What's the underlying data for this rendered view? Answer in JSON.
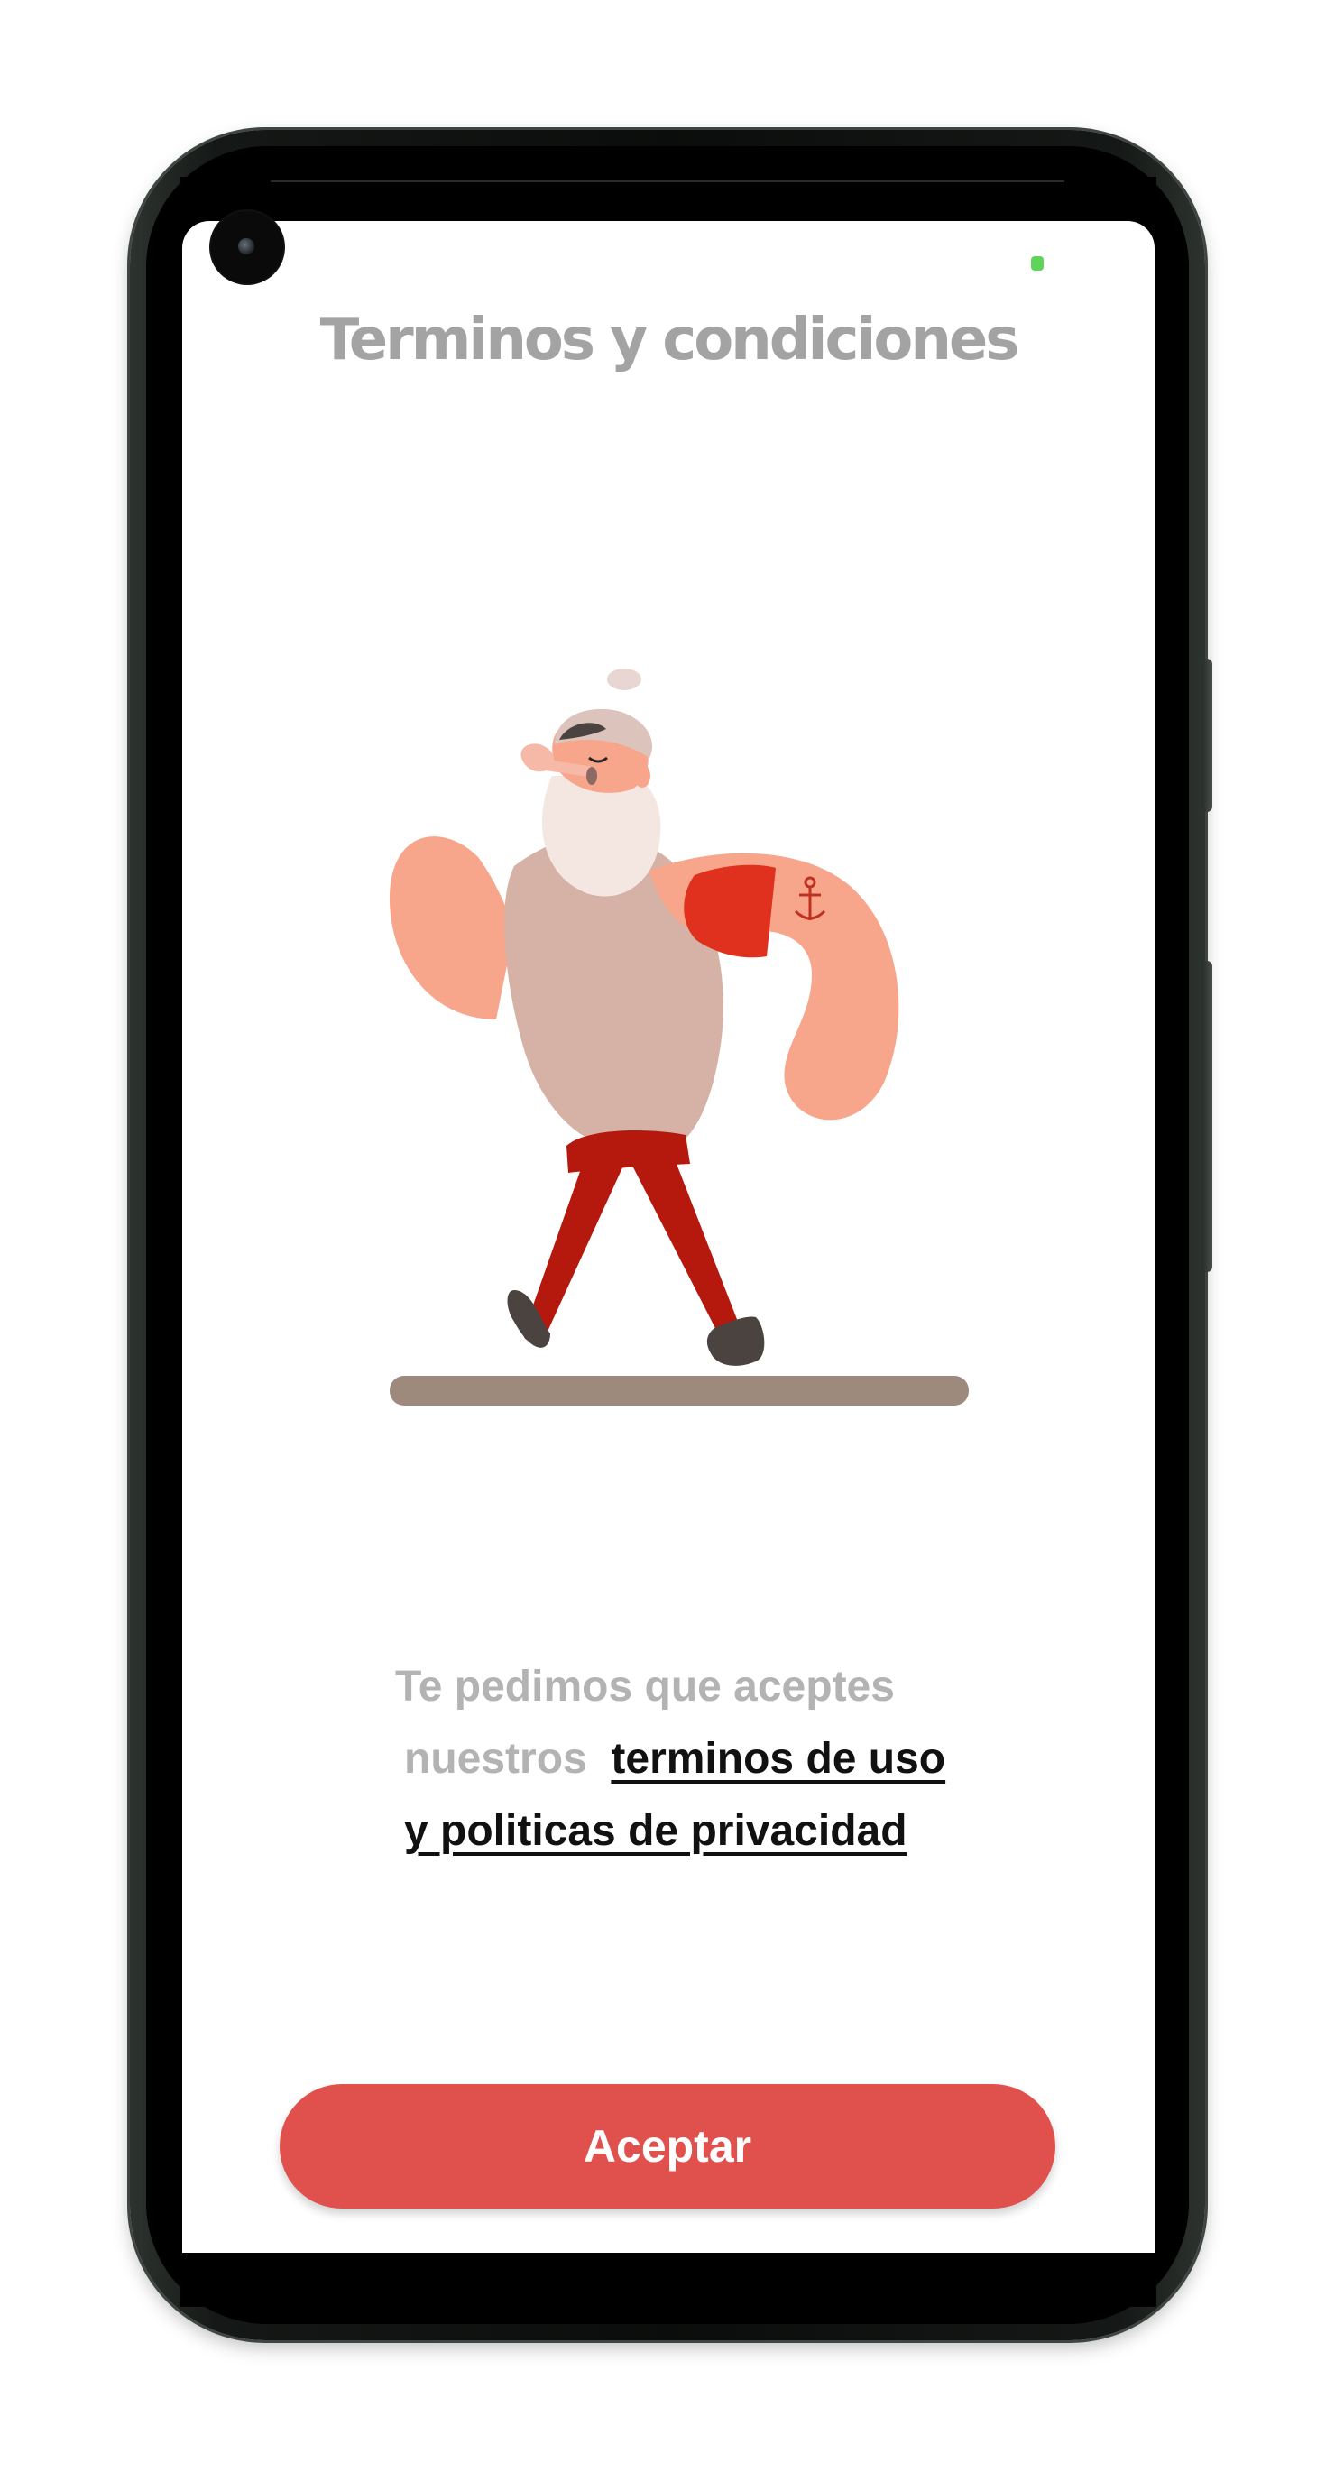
{
  "screen": {
    "title": "Terminos y condiciones",
    "message": {
      "line1": "Te pedimos que aceptes",
      "line2_prefix": "nuestros",
      "link_part1": "terminos de uso",
      "link_part2": "y politicas de privacidad"
    },
    "accept_button": "Aceptar"
  },
  "illustration": {
    "subject": "walking sailor with pipe and anchor tattoo",
    "icon": "anchor-icon"
  },
  "colors": {
    "title": "#a3a3a3",
    "message_muted": "#b3b3b3",
    "link": "#111111",
    "button": "#e0504d",
    "status_indicator": "#5fd45a"
  }
}
